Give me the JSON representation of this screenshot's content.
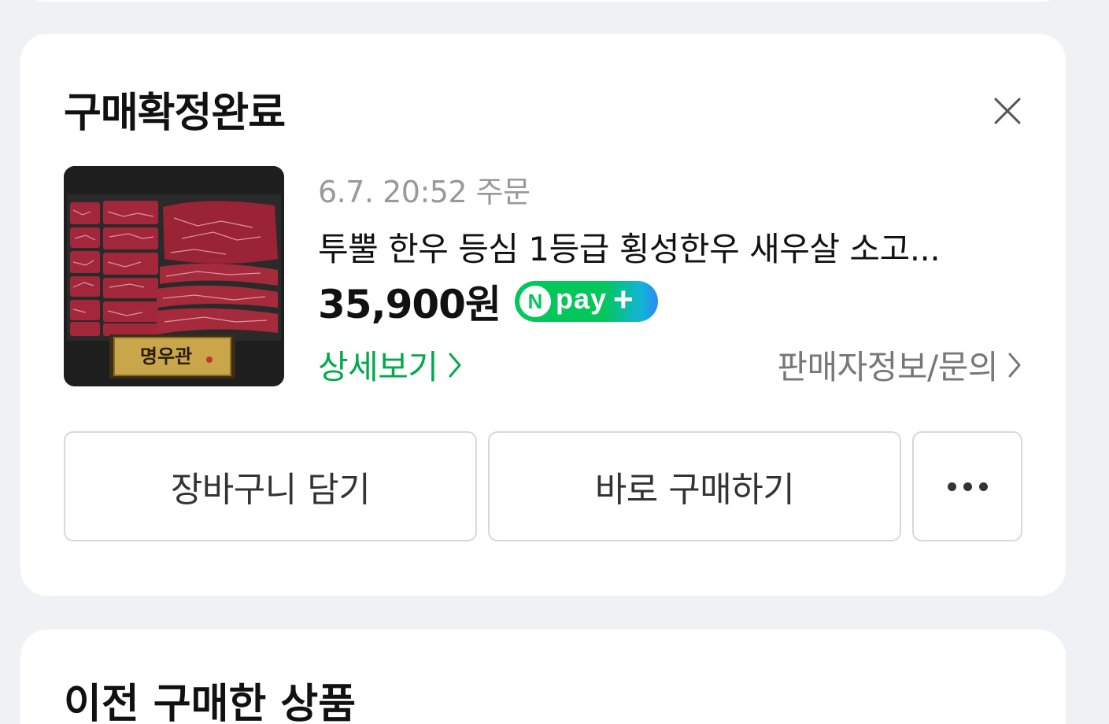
{
  "card": {
    "title": "구매확정완료",
    "order_date": "6.7. 20:52 주문",
    "product_name": "투뿔 한우 등심 1등급 횡성한우 새우살 소고...",
    "price": "35,900원",
    "npay_badge": {
      "n": "N",
      "text": "pay",
      "plus": "+"
    },
    "detail_link": "상세보기",
    "seller_link": "판매자정보/문의",
    "thumbnail_label": "명우관",
    "buttons": {
      "cart": "장바구니 담기",
      "buy": "바로 구매하기"
    }
  },
  "next_card": {
    "title": "이전 구매한 상품"
  },
  "colors": {
    "accent_green": "#03a94d",
    "npay_green": "#03c75a",
    "background": "#eff2f5"
  },
  "icons": [
    "close-icon",
    "chevron-right-icon",
    "more-icon"
  ]
}
